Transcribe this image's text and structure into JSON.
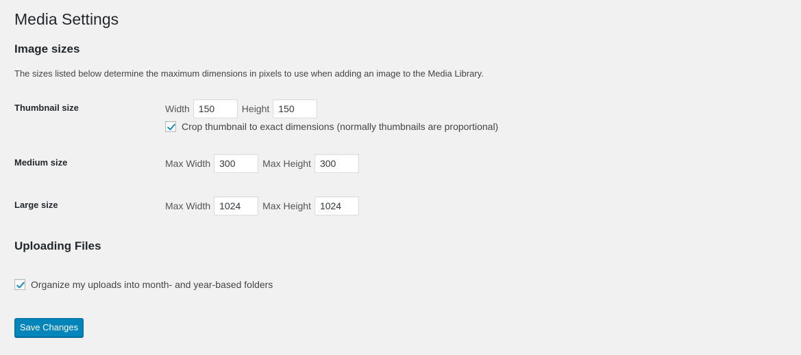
{
  "page": {
    "title": "Media Settings"
  },
  "image_sizes": {
    "heading": "Image sizes",
    "description": "The sizes listed below determine the maximum dimensions in pixels to use when adding an image to the Media Library.",
    "thumbnail": {
      "label": "Thumbnail size",
      "width_label": "Width",
      "width_value": "150",
      "height_label": "Height",
      "height_value": "150",
      "crop_label": "Crop thumbnail to exact dimensions (normally thumbnails are proportional)",
      "crop_checked": true
    },
    "medium": {
      "label": "Medium size",
      "width_label": "Max Width",
      "width_value": "300",
      "height_label": "Max Height",
      "height_value": "300"
    },
    "large": {
      "label": "Large size",
      "width_label": "Max Width",
      "width_value": "1024",
      "height_label": "Max Height",
      "height_value": "1024"
    }
  },
  "uploading": {
    "heading": "Uploading Files",
    "organize_label": "Organize my uploads into month- and year-based folders",
    "organize_checked": true
  },
  "actions": {
    "save_label": "Save Changes"
  },
  "colors": {
    "background": "#f1f1f1",
    "primary": "#0085ba",
    "check": "#1e8cbe"
  },
  "icons": {
    "checkmark": "checkmark-icon"
  }
}
